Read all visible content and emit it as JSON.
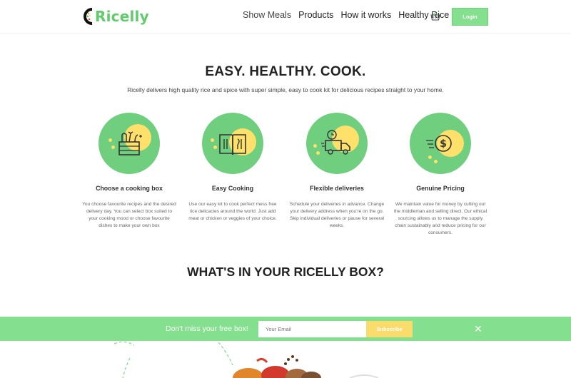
{
  "header": {
    "logo_text": "Ricelly",
    "nav": [
      "Show Meals",
      "Products",
      "How it works",
      "Healthy Rice"
    ],
    "login_label": "Login",
    "brand_color": "#5fcb6a"
  },
  "hero": {
    "title": "EASY. HEALTHY. COOK.",
    "subtitle": "Ricelly delivers high quality rice and spice with super simple, easy to cook kit for delicious recipes straight to your home."
  },
  "features": [
    {
      "icon": "cooking-box-icon",
      "title": "Choose a cooking box",
      "text": "You choose favourite recipes and the desired delivery day. You can select box suited to your cooking mood or choose favourite dishes to make your own box"
    },
    {
      "icon": "recipe-book-icon",
      "title": "Easy Cooking",
      "text": "Use our easy kit to cook perfect mess free rice delicacies around the world. Just add meat or chicken or veggies of your choice."
    },
    {
      "icon": "delivery-truck-icon",
      "title": "Flexible deliveries",
      "text": "Schedule your deliveries in advance. Change your delivery address when you're on the go. Skip individual deliveries or pause for several weeks."
    },
    {
      "icon": "dollar-coin-icon",
      "title": "Genuine Pricing",
      "text": "We maintain value for money by cutting out the middleman and selling direct. Our ethical sourcing allows us to manage the supply chain sustainably and reduce pricing for our consumers."
    }
  ],
  "section": {
    "box_title": "WHAT'S IN YOUR RICELLY BOX?"
  },
  "newsletter": {
    "label": "Don't miss your free box!",
    "email_placeholder": "Your Email",
    "subscribe_label": "Subscribe",
    "close_icon": "close-icon",
    "bar_color": "#84e08e",
    "button_color": "#f9dc6c"
  }
}
